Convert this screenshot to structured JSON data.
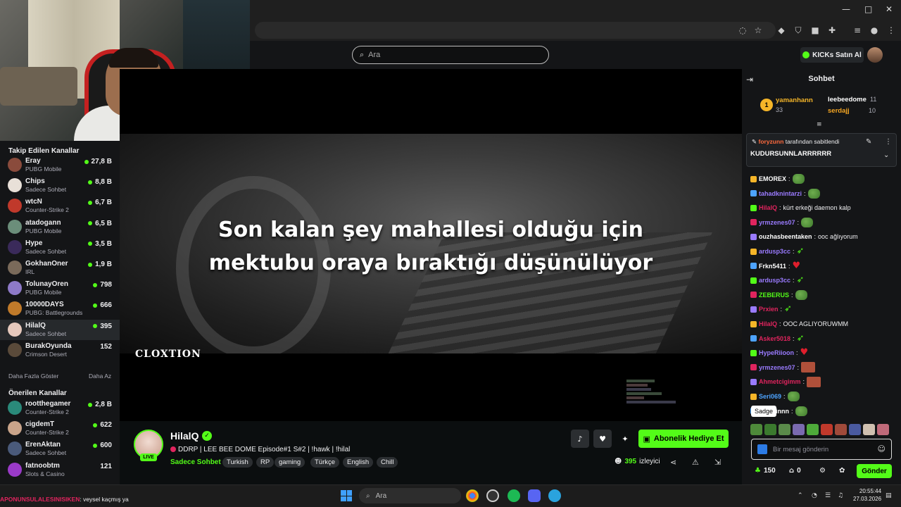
{
  "header": {
    "search_placeholder": "Ara",
    "kicks_button": "KICKs Satın Al"
  },
  "sidebar": {
    "followed_title": "Takip Edilen Kanallar",
    "followed": [
      {
        "name": "Eray",
        "category": "PUBG Mobile",
        "viewers": "27,8 B",
        "live": true,
        "color": "#8a4b3c"
      },
      {
        "name": "Chips",
        "category": "Sadece Sohbet",
        "viewers": "8,8 B",
        "live": true,
        "color": "#e8e0d8"
      },
      {
        "name": "wtcN",
        "category": "Counter-Strike 2",
        "viewers": "6,7 B",
        "live": true,
        "color": "#c0392b"
      },
      {
        "name": "atadogann",
        "category": "PUBG Mobile",
        "viewers": "6,5 B",
        "live": true,
        "color": "#6b8e7a"
      },
      {
        "name": "Hype",
        "category": "Sadece Sohbet",
        "viewers": "3,5 B",
        "live": true,
        "color": "#3a2a5a"
      },
      {
        "name": "GokhanOner",
        "category": "IRL",
        "viewers": "1,9 B",
        "live": true,
        "color": "#7a6a5a"
      },
      {
        "name": "TolunayOren",
        "category": "PUBG Mobile",
        "viewers": "798",
        "live": true,
        "color": "#8e7ac8"
      },
      {
        "name": "10000DAYS",
        "category": "PUBG: Battlegrounds",
        "viewers": "666",
        "live": true,
        "color": "#c07a2a"
      },
      {
        "name": "HilalQ",
        "category": "Sadece Sohbet",
        "viewers": "395",
        "live": true,
        "color": "#e6c9bd"
      },
      {
        "name": "BurakOyunda",
        "category": "Crimson Desert",
        "viewers": "152",
        "live": false,
        "color": "#5a4a3a"
      }
    ],
    "show_more": "Daha Fazla Göster",
    "show_less": "Daha Az",
    "recommended_title": "Önerilen Kanallar",
    "recommended": [
      {
        "name": "rootthegamer",
        "category": "Counter-Strike 2",
        "viewers": "2,8 B",
        "live": true,
        "color": "#2a8a7a"
      },
      {
        "name": "cigdemT",
        "category": "Counter-Strike 2",
        "viewers": "622",
        "live": true,
        "color": "#c9a48a"
      },
      {
        "name": "ErenAktan",
        "category": "Sadece Sohbet",
        "viewers": "600",
        "live": true,
        "color": "#4a5a7a"
      },
      {
        "name": "fatnoobtm",
        "category": "Slots & Casino",
        "viewers": "121",
        "live": false,
        "color": "#9a3ac8"
      }
    ]
  },
  "video": {
    "subtitle_line1": "Son kalan şey mahallesi olduğu için",
    "subtitle_line2": "mektubu oraya bıraktığı düşünülüyor",
    "watermark": "CLOXTION"
  },
  "stream": {
    "streamer": "HilalQ",
    "live_label": "LIVE",
    "title": "DDRP | LEE BEE DOME Episode#1 S#2 | !hawk | !hilal",
    "category": "Sadece Sohbet",
    "tags": [
      "Turkish",
      "RP",
      "gaming",
      "Türkçe",
      "English",
      "Chill"
    ],
    "gift_button": "Abonelik Hediye Et",
    "viewer_count": "395",
    "viewer_label": "izleyici"
  },
  "chat": {
    "title": "Sohbet",
    "gifters": [
      {
        "name": "yamanhann",
        "count": "33",
        "color": "#f5b528"
      },
      {
        "name": "leebeedome",
        "count": "11",
        "color": "#ffffff"
      },
      {
        "name": "serdajj",
        "count": "10",
        "color": "#f5a623"
      }
    ],
    "pinned_by_user": "foryzunn",
    "pinned_by_text": "tarafından sabitlendi",
    "pinned_message": "KUDURSUNNLARRRRRR",
    "messages": [
      {
        "user": "EMOREX",
        "color": "#ffffff",
        "text": "",
        "emote": "pepe"
      },
      {
        "user": "tahadknintarzi",
        "color": "#9a7bff",
        "text": "",
        "emote": "pepe"
      },
      {
        "user": "HilalQ",
        "color": "#e0245e",
        "text": "kürt erkeği daemon kalp",
        "emote": ""
      },
      {
        "user": "yrmzenes07",
        "color": "#9a7bff",
        "text": "",
        "emote": "pepe"
      },
      {
        "user": "ouzhasbeentaken",
        "color": "#ffffff",
        "text": "ooc ağlıyorum",
        "emote": ""
      },
      {
        "user": "ardusp3cc",
        "color": "#9a7bff",
        "text": "",
        "emote": "feather"
      },
      {
        "user": "Frkn5411",
        "color": "#ffffff",
        "text": "",
        "emote": "heart"
      },
      {
        "user": "ardusp3cc",
        "color": "#9a7bff",
        "text": "",
        "emote": "feather"
      },
      {
        "user": "ZEBERUS",
        "color": "#53fc18",
        "text": "",
        "emote": "pepe"
      },
      {
        "user": "Prxien",
        "color": "#e0245e",
        "text": "",
        "emote": "feather"
      },
      {
        "user": "HilalQ",
        "color": "#e0245e",
        "text": "OOC AGLIYORUWMM",
        "emote": ""
      },
      {
        "user": "Asker5018",
        "color": "#e0245e",
        "text": "",
        "emote": "feather"
      },
      {
        "user": "HypeRiioon",
        "color": "#9a7bff",
        "text": "",
        "emote": "heart"
      },
      {
        "user": "yrmzenes07",
        "color": "#9a7bff",
        "text": "",
        "emote": "red"
      },
      {
        "user": "Ahmetcigimm",
        "color": "#e0245e",
        "text": "",
        "emote": "red"
      },
      {
        "user": "Seri069",
        "color": "#4da3ff",
        "text": "",
        "emote": "pepe"
      },
      {
        "user": "muhsinnn",
        "color": "#ffffff",
        "text": "",
        "emote": "pepe"
      }
    ],
    "tooltip": "Sadge",
    "input_placeholder": "Bir mesaj gönderin",
    "points": "150",
    "cart": "0",
    "send": "Gönder"
  },
  "ticker": {
    "user": "APONUNSULALESINISIKEN",
    "text": ": veysel kaçmış ya"
  },
  "taskbar": {
    "search": "Ara",
    "time": "20:55:44",
    "date": "27.03.2026"
  }
}
